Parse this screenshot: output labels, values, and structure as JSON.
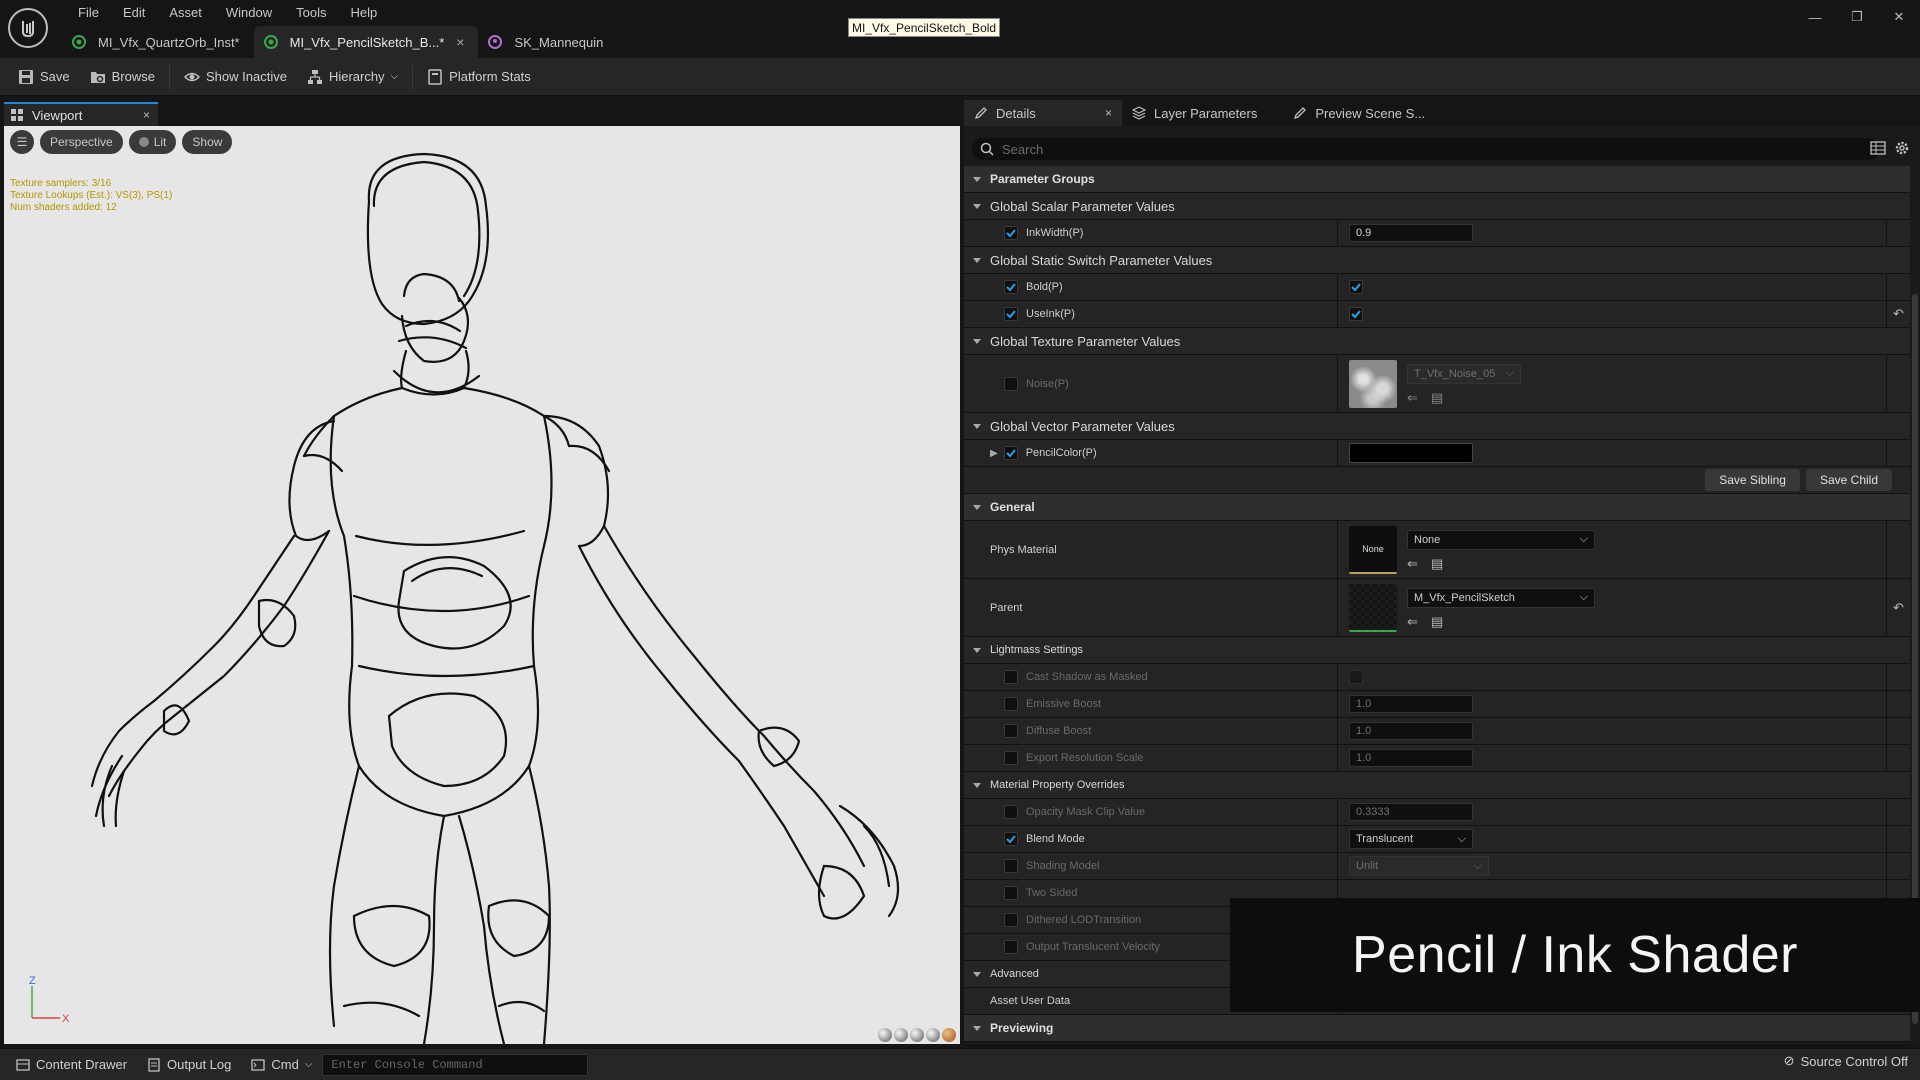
{
  "menu": [
    "File",
    "Edit",
    "Asset",
    "Window",
    "Tools",
    "Help"
  ],
  "doc_tabs": [
    {
      "label": "MI_Vfx_QuartzOrb_Inst*"
    },
    {
      "label": "MI_Vfx_PencilSketch_B...*"
    },
    {
      "label": "SK_Mannequin"
    }
  ],
  "tooltip": "MI_Vfx_PencilSketch_Bold",
  "toolbar": {
    "save": "Save",
    "browse": "Browse",
    "show_inactive": "Show Inactive",
    "hierarchy": "Hierarchy",
    "platform_stats": "Platform Stats"
  },
  "viewport": {
    "tab": "Viewport",
    "perspective": "Perspective",
    "lit": "Lit",
    "show": "Show",
    "stats": [
      "Texture samplers: 3/16",
      "Texture Lookups (Est.): VS(3), PS(1)",
      "Num shaders added: 12"
    ],
    "axis_z": "Z",
    "axis_x": "X"
  },
  "panel_tabs": {
    "details": "Details",
    "layer_params": "Layer Parameters",
    "preview_scene": "Preview Scene S..."
  },
  "search": {
    "placeholder": "Search"
  },
  "details": {
    "param_groups": "Parameter Groups",
    "scalar_group": "Global Scalar Parameter Values",
    "ink_width": {
      "label": "InkWidth(P)",
      "value": "0.9"
    },
    "switch_group": "Global Static Switch Parameter Values",
    "bold": {
      "label": "Bold(P)"
    },
    "use_ink": {
      "label": "UseInk(P)"
    },
    "texture_group": "Global Texture Parameter Values",
    "noise": {
      "label": "Noise(P)",
      "asset": "T_Vfx_Noise_05"
    },
    "vector_group": "Global Vector Parameter Values",
    "pencil_color": {
      "label": "PencilColor(P)"
    },
    "save_sibling": "Save Sibling",
    "save_child": "Save Child",
    "general": "General",
    "phys_material": {
      "label": "Phys Material",
      "thumb": "None",
      "value": "None"
    },
    "parent": {
      "label": "Parent",
      "value": "M_Vfx_PencilSketch"
    },
    "lightmass": "Lightmass Settings",
    "cast_shadow": {
      "label": "Cast Shadow as Masked"
    },
    "emissive_boost": {
      "label": "Emissive Boost",
      "value": "1.0"
    },
    "diffuse_boost": {
      "label": "Diffuse Boost",
      "value": "1.0"
    },
    "export_res": {
      "label": "Export Resolution Scale",
      "value": "1.0"
    },
    "overrides": "Material Property Overrides",
    "opacity_clip": {
      "label": "Opacity Mask Clip Value",
      "value": "0.3333"
    },
    "blend_mode": {
      "label": "Blend Mode",
      "value": "Translucent"
    },
    "shading_model": {
      "label": "Shading Model",
      "value": "Unlit"
    },
    "two_sided": {
      "label": "Two Sided"
    },
    "dithered": {
      "label": "Dithered LODTransition"
    },
    "output_velocity": {
      "label": "Output Translucent Velocity"
    },
    "advanced": "Advanced",
    "asset_user_data": "Asset User Data",
    "previewing": "Previewing"
  },
  "banner": "Pencil / Ink Shader",
  "statusbar": {
    "content_drawer": "Content Drawer",
    "output_log": "Output Log",
    "cmd": "Cmd",
    "console_placeholder": "Enter Console Command",
    "source_control": "Source Control Off"
  },
  "colors": {
    "accent": "#1a8bd8",
    "check": "#1a8bd8",
    "tooltip_bg": "#fffbe6"
  }
}
